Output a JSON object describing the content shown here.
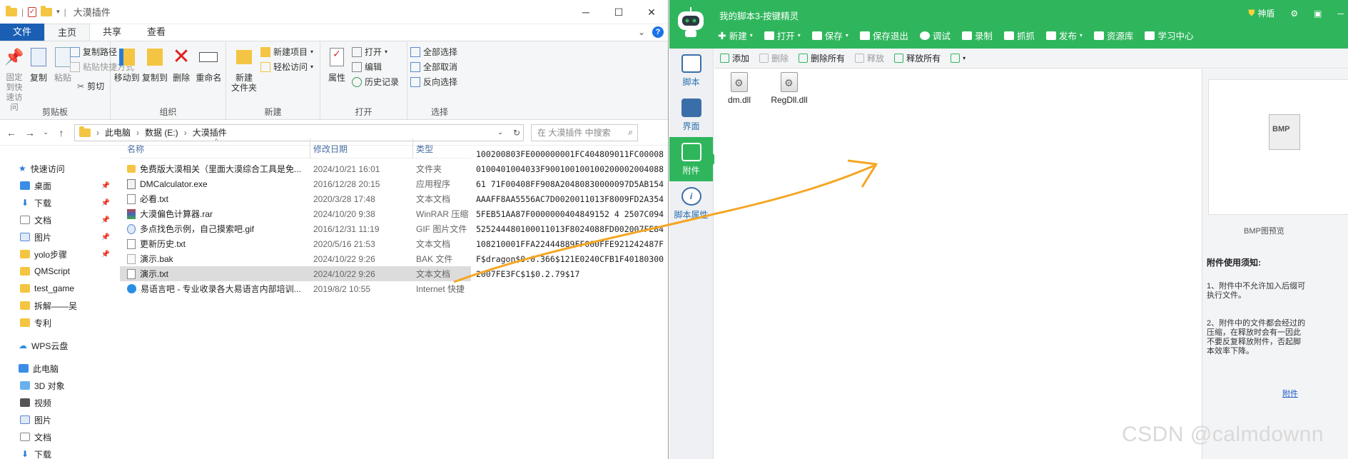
{
  "explorer": {
    "title": "大漠插件",
    "tabs": {
      "file": "文件",
      "home": "主页",
      "share": "共享",
      "view": "查看"
    },
    "ribbon": {
      "clipboard": {
        "label": "剪贴板",
        "pin": "固定到快\n速访问",
        "copy": "复制",
        "paste": "粘贴",
        "copy_path": "复制路径",
        "paste_shortcut": "粘贴快捷方式",
        "cut": "剪切"
      },
      "organize": {
        "label": "组织",
        "move_to": "移动到",
        "copy_to": "复制到",
        "delete": "删除",
        "rename": "重命名"
      },
      "new": {
        "label": "新建",
        "new_folder": "新建\n文件夹",
        "new_item": "新建项目",
        "easy_access": "轻松访问"
      },
      "open": {
        "label": "打开",
        "properties": "属性",
        "open": "打开",
        "edit": "编辑",
        "history": "历史记录"
      },
      "select": {
        "label": "选择",
        "select_all": "全部选择",
        "select_none": "全部取消",
        "invert": "反向选择"
      }
    },
    "address": {
      "pc": "此电脑",
      "drive": "数据 (E:)",
      "folder": "大漠插件"
    },
    "search_placeholder": "在 大漠插件 中搜索",
    "nav": {
      "quick_access": "快速访问",
      "pinned": [
        "桌面",
        "下载",
        "文档",
        "图片",
        "yolo步骤"
      ],
      "folders": [
        "QMScript",
        "test_game",
        "拆解——吴",
        "专利"
      ],
      "wps": "WPS云盘",
      "this_pc": "此电脑",
      "pc_items": [
        "3D 对象",
        "视频",
        "图片",
        "文档",
        "下载"
      ]
    },
    "columns": {
      "name": "名称",
      "date": "修改日期",
      "type": "类型"
    },
    "files": [
      {
        "name": "免费版大漠相关（里面大漠综合工具是免...",
        "date": "2024/10/21 16:01",
        "type": "文件夹",
        "icon": "folder"
      },
      {
        "name": "DMCalculator.exe",
        "date": "2016/12/28 20:15",
        "type": "应用程序",
        "icon": "exe"
      },
      {
        "name": "必看.txt",
        "date": "2020/3/28 17:48",
        "type": "文本文档",
        "icon": "txt"
      },
      {
        "name": "大漠偏色计算器.rar",
        "date": "2024/10/20 9:38",
        "type": "WinRAR 压缩",
        "icon": "rar"
      },
      {
        "name": "多点找色示例，自己摸索吧.gif",
        "date": "2016/12/31 11:19",
        "type": "GIF 图片文件",
        "icon": "gif"
      },
      {
        "name": "更新历史.txt",
        "date": "2020/5/16 21:53",
        "type": "文本文档",
        "icon": "txt"
      },
      {
        "name": "演示.bak",
        "date": "2024/10/22 9:26",
        "type": "BAK 文件",
        "icon": "file"
      },
      {
        "name": "演示.txt",
        "date": "2024/10/22 9:26",
        "type": "文本文档",
        "icon": "txt",
        "selected": true
      },
      {
        "name": "易语言吧 - 专业收录各大易语言内部培训...",
        "date": "2019/8/2 10:55",
        "type": "Internet 快捷",
        "icon": "web"
      }
    ],
    "preview_text": "100200803FE000000001FC404809011FC000080100401004033F90010010010020000200408861 71F00408FF908A20480830000097D5AB154AAAFF8AA5556AC7D0020011013F8009FD2A3545FEB51AA87F0000000404849152 4 2507C094525244480100011013F8024088FD002007FE84108210001FFA22444889FF000FFE921242487FF$dragon$0.0.366$121E0240CFB1F401803002007FE3FC$1$0.2.79$17"
  },
  "qmscript": {
    "title": "我的脚本3-按键精灵",
    "shield": "神盾",
    "toolbar": [
      "新建",
      "打开",
      "保存",
      "保存退出",
      "调试",
      "录制",
      "抓抓",
      "发布",
      "资源库",
      "学习中心"
    ],
    "sidebar": [
      "脚本",
      "界面",
      "附件",
      "脚本属性"
    ],
    "attach_toolbar": [
      "添加",
      "删除",
      "删除所有",
      "释放",
      "释放所有"
    ],
    "attachments": [
      "dm.dll",
      "RegDll.dll"
    ],
    "preview_label": "BMP图预览",
    "notice_title": "附件使用须知:",
    "notice1": "1、附件中不允许加入后缀可执行文件。",
    "notice2": "2、附件中的文件都会经过的压缩，在释放时会有一因此不要反复释放附件，否起脚本效率下降。",
    "link": "附件",
    "bmp": "BMP"
  },
  "watermark": "CSDN @calmdownn",
  "colors": {
    "qm_green": "#2fb65c",
    "file_tab_blue": "#1a5fb4",
    "arrow": "#f5a623"
  }
}
